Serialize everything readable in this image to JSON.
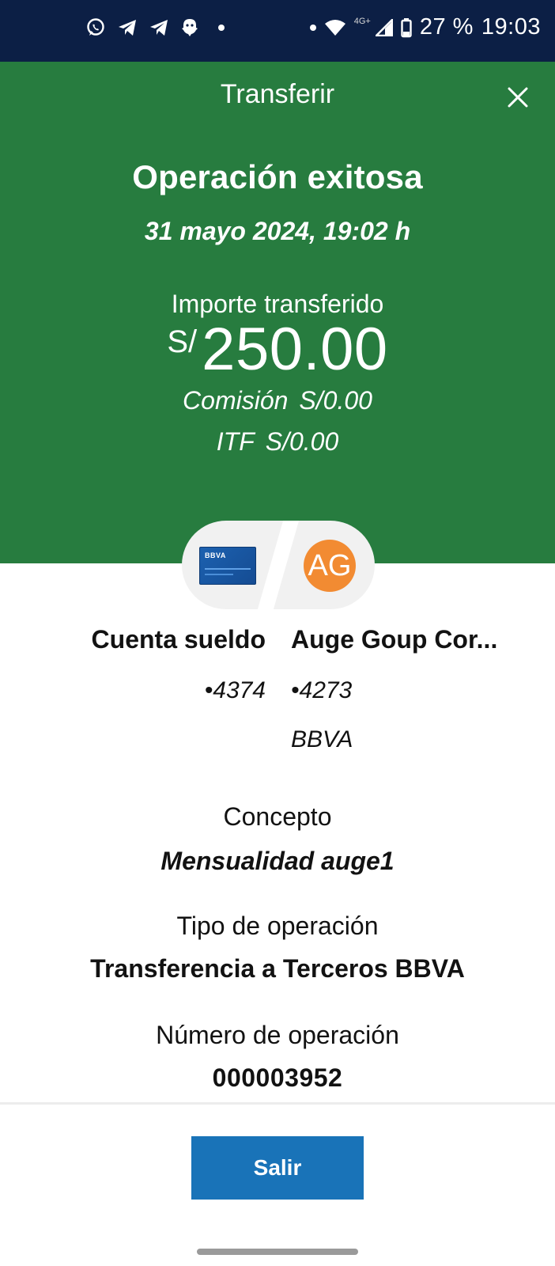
{
  "status_bar": {
    "battery": "27 %",
    "time": "19:03",
    "network": "4G+",
    "icons": [
      "whatsapp-icon",
      "telegram-icon",
      "telegram-icon",
      "snapchat-icon",
      "notification-dot",
      "notification-dot",
      "wifi-icon",
      "signal-icon",
      "battery-icon"
    ]
  },
  "header": {
    "title": "Transferir",
    "close_icon": "close-icon"
  },
  "result": {
    "status_title": "Operación exitosa",
    "datetime": "31 mayo 2024, 19:02 h",
    "amount_label": "Importe transferido",
    "currency_symbol": "S/",
    "amount": "250.00",
    "fee_label": "Comisión",
    "fee_value": "S/0.00",
    "itf_label": "ITF",
    "itf_value": "S/0.00"
  },
  "pill": {
    "card_brand": "BBVA",
    "avatar_initials": "AG"
  },
  "origin": {
    "name": "Cuenta sueldo",
    "number": "•4374"
  },
  "destination": {
    "name": "Auge Goup Cor...",
    "number": "•4273",
    "bank": "BBVA"
  },
  "details": {
    "concept_label": "Concepto",
    "concept_value": "Mensualidad auge1",
    "operation_type_label": "Tipo de operación",
    "operation_type_value": "Transferencia a Terceros BBVA",
    "operation_number_label": "Número de operación",
    "operation_number_value": "000003952"
  },
  "footer": {
    "exit_label": "Salir"
  },
  "colors": {
    "status_bar": "#0c1f45",
    "success_green": "#277c3f",
    "primary_button": "#1973b8",
    "avatar": "#f28b32",
    "card": "#1c61b0"
  }
}
